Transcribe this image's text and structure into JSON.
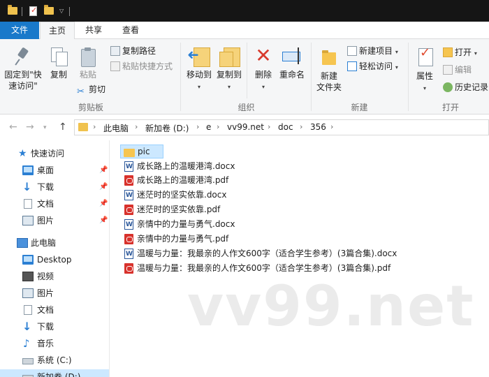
{
  "ribbon_tabs": {
    "file": "文件",
    "home": "主页",
    "share": "共享",
    "view": "查看"
  },
  "ribbon": {
    "clipboard": {
      "group_label": "剪贴板",
      "pin_label": "固定到\"快\n速访问\"",
      "copy_label": "复制",
      "paste_label": "粘贴",
      "copy_path": "复制路径",
      "paste_shortcut": "粘贴快捷方式",
      "cut": "剪切"
    },
    "organize": {
      "group_label": "组织",
      "move_to": "移动到",
      "copy_to": "复制到",
      "delete": "删除",
      "rename": "重命名"
    },
    "new": {
      "group_label": "新建",
      "new_folder": "新建\n文件夹",
      "new_item": "新建项目",
      "easy_access": "轻松访问"
    },
    "open": {
      "group_label": "打开",
      "properties": "属性",
      "open": "打开",
      "edit": "编辑",
      "history": "历史记录"
    }
  },
  "address": {
    "crumbs": [
      "此电脑",
      "新加卷 (D:)",
      "e",
      "vv99.net",
      "doc",
      "356"
    ]
  },
  "nav_pane": {
    "quick_access": "快速访问",
    "quick_items": [
      "桌面",
      "下载",
      "文档",
      "图片"
    ],
    "this_pc": "此电脑",
    "pc_items": [
      "Desktop",
      "视频",
      "图片",
      "文档",
      "下载",
      "音乐",
      "系统 (C:)",
      "新加卷 (D:)"
    ]
  },
  "files": [
    {
      "name": "pic",
      "type": "folder"
    },
    {
      "name": "成长路上的温暖港湾.docx",
      "type": "word"
    },
    {
      "name": "成长路上的温暖港湾.pdf",
      "type": "pdf"
    },
    {
      "name": "迷茫时的坚实依靠.docx",
      "type": "word"
    },
    {
      "name": "迷茫时的坚实依靠.pdf",
      "type": "pdf"
    },
    {
      "name": "亲情中的力量与勇气.docx",
      "type": "word"
    },
    {
      "name": "亲情中的力量与勇气.pdf",
      "type": "pdf"
    },
    {
      "name": "温暖与力量：我最亲的人作文600字（适合学生参考）(3篇合集).docx",
      "type": "word"
    },
    {
      "name": "温暖与力量：我最亲的人作文600字（适合学生参考）(3篇合集).pdf",
      "type": "pdf"
    }
  ],
  "watermark": "vv99.net",
  "colors": {
    "file_tab": "#1979ca",
    "selection": "#cce8ff",
    "folder": "#f6c550",
    "pdf": "#d8322c",
    "word": "#2b579a"
  }
}
